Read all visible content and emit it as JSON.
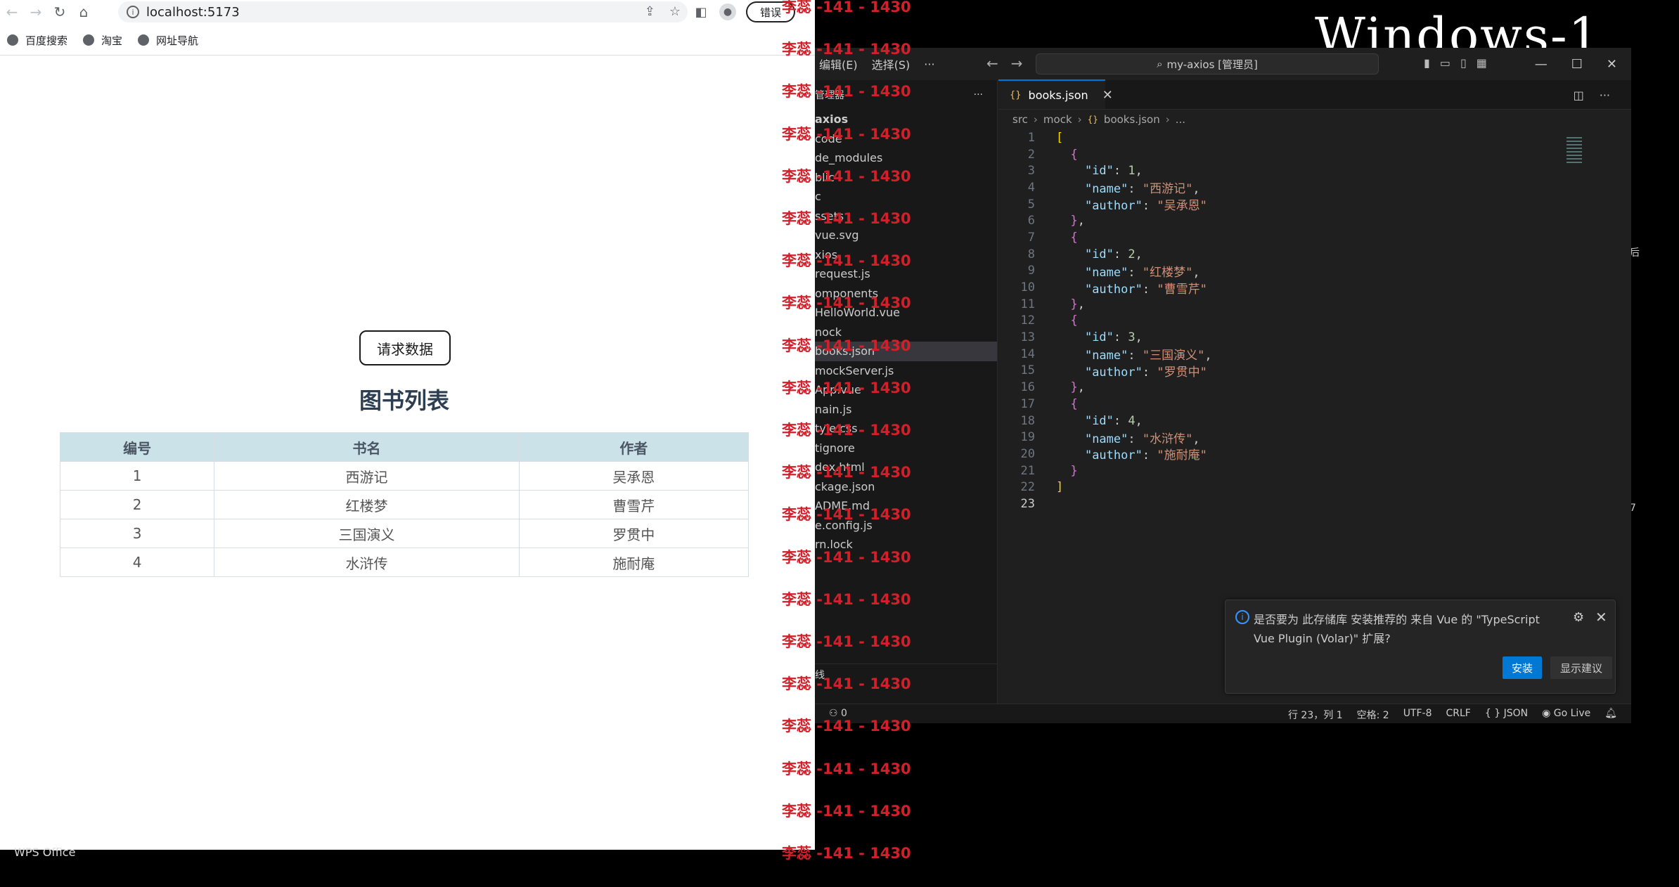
{
  "browser": {
    "url": "localhost:5173",
    "error_button": "错误",
    "bookmarks": [
      "百度搜索",
      "淘宝",
      "网址导航"
    ]
  },
  "page": {
    "request_button": "请求数据",
    "title": "图书列表",
    "table": {
      "headers": [
        "编号",
        "书名",
        "作者"
      ],
      "rows": [
        [
          "1",
          "西游记",
          "吴承恩"
        ],
        [
          "2",
          "红楼梦",
          "曹雪芹"
        ],
        [
          "3",
          "三国演义",
          "罗贯中"
        ],
        [
          "4",
          "水浒传",
          "施耐庵"
        ]
      ]
    }
  },
  "taskbar_label": "WPS Office",
  "desktop_title": "Windows-1",
  "vscode": {
    "menu": [
      "编辑(E)",
      "选择(S)",
      "···"
    ],
    "search_box": "my-axios [管理员]",
    "explorer_header": "管理器",
    "tree": [
      "axios",
      "code",
      "de_modules",
      "blic",
      "c",
      "ssets",
      "vue.svg",
      "xios",
      "request.js",
      "omponents",
      "HelloWorld.vue",
      "nock",
      "books.json",
      "mockServer.js",
      "App.vue",
      "nain.js",
      "tyle.css",
      "tignore",
      "dex.html",
      "ckage.json",
      "ADME.md",
      "e.config.js",
      "rn.lock"
    ],
    "sidebar_bottom": "线",
    "tab": "books.json",
    "breadcrumb": [
      "src",
      "mock",
      "books.json",
      "..."
    ],
    "code_lines": [
      "[",
      "  {",
      "    \"id\": 1,",
      "    \"name\": \"西游记\",",
      "    \"author\": \"吴承恩\"",
      "  },",
      "  {",
      "    \"id\": 2,",
      "    \"name\": \"红楼梦\",",
      "    \"author\": \"曹雪芹\"",
      "  },",
      "  {",
      "    \"id\": 3,",
      "    \"name\": \"三国演义\",",
      "    \"author\": \"罗贯中\"",
      "  },",
      "  {",
      "    \"id\": 4,",
      "    \"name\": \"水浒传\",",
      "    \"author\": \"施耐庵\"",
      "  }",
      "]",
      ""
    ],
    "notification": {
      "text": "是否要为 此存储库 安装推荐的 来自 Vue 的 \"TypeScript Vue Plugin (Volar)\" 扩展?",
      "install": "安装",
      "suggest": "显示建议"
    },
    "status": {
      "ports": "0",
      "position": "行 23，列 1",
      "spaces": "空格: 2",
      "encoding": "UTF-8",
      "eol": "CRLF",
      "language": "{ } JSON",
      "golive": "Go Live"
    }
  },
  "watermark": "李蕊 -141 - 1430",
  "colors": {
    "accent": "#0078d4",
    "table_header": "#cbe3e8",
    "watermark": "#d2202a"
  }
}
